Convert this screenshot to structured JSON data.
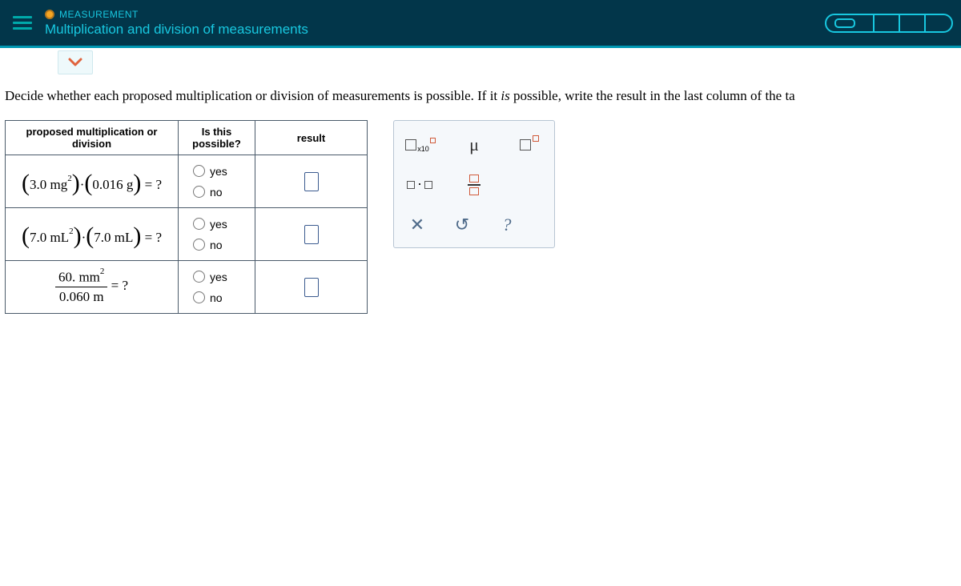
{
  "header": {
    "subject_label": "MEASUREMENT",
    "topic_title": "Multiplication and division of measurements"
  },
  "instruction_pre": "Decide whether each proposed multiplication or division of measurements is possible. If it ",
  "instruction_em": "is",
  "instruction_post": " possible, write the result in the last column of the ta",
  "table": {
    "headers": {
      "proposed": "proposed multiplication or division",
      "possible": "Is this possible?",
      "result": "result"
    },
    "rows": [
      {
        "expr": {
          "a_val": "3.0",
          "a_unit": "mg",
          "a_exp": "2",
          "b_val": "0.016",
          "b_unit": "g",
          "tail": " = ?"
        },
        "yes_label": "yes",
        "no_label": "no",
        "yes_selected": true
      },
      {
        "expr": {
          "a_val": "7.0",
          "a_unit": "mL",
          "a_exp": "2",
          "b_val": "7.0",
          "b_unit": "mL",
          "tail": " = ?"
        },
        "yes_label": "yes",
        "no_label": "no",
        "yes_selected": false
      },
      {
        "expr_frac": {
          "num_val": "60.",
          "num_unit": "mm",
          "num_exp": "2",
          "den_val": "0.060",
          "den_unit": "m",
          "tail": " = ?"
        },
        "yes_label": "yes",
        "no_label": "no",
        "yes_selected": false
      }
    ]
  },
  "toolbox": {
    "x10_label": "x10",
    "mu_label": "μ",
    "clear_label": "✕",
    "undo_label": "↺",
    "help_label": "?"
  }
}
